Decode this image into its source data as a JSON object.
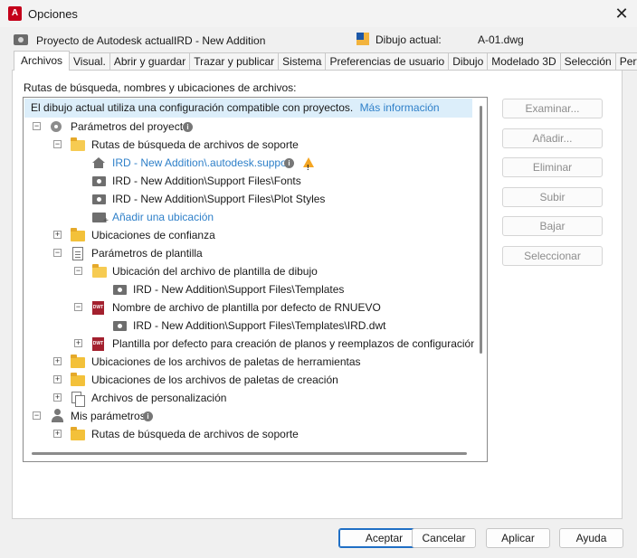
{
  "window": {
    "title": "Opciones",
    "app_icon_letter": "A",
    "close_glyph": "✕"
  },
  "header": {
    "project_label": "Proyecto de Autodesk actual:",
    "project_value": "IRD - New Addition",
    "drawing_label": "Dibujo actual:",
    "drawing_value": "A-01.dwg"
  },
  "tabs": [
    "Archivos",
    "Visual.",
    "Abrir y guardar",
    "Trazar y publicar",
    "Sistema",
    "Preferencias de usuario",
    "Dibujo",
    "Modelado 3D",
    "Selección",
    "Perfil"
  ],
  "active_tab": "Archivos",
  "panel": {
    "caption": "Rutas de búsqueda, nombres y ubicaciones de archivos:",
    "banner_text": "El dibujo actual utiliza una configuración compatible con proyectos.",
    "banner_link": "Más información"
  },
  "tree": [
    {
      "label": "Parámetros del proyecto",
      "icon": "gear-icon",
      "has_info": true
    },
    {
      "label": "Rutas de búsqueda de archivos de soporte",
      "icon": "folder-open-icon"
    },
    {
      "label": "IRD - New Addition\\.autodesk.support",
      "icon": "house-icon",
      "link": true,
      "has_info": true,
      "has_warning": true
    },
    {
      "label": "IRD - New Addition\\Support Files\\Fonts",
      "icon": "folder-path-icon"
    },
    {
      "label": "IRD - New Addition\\Support Files\\Plot Styles",
      "icon": "folder-path-icon"
    },
    {
      "label": "Añadir una ubicación",
      "icon": "add-folder-icon",
      "link": true
    },
    {
      "label": "Ubicaciones de confianza",
      "icon": "folder-icon"
    },
    {
      "label": "Parámetros de plantilla",
      "icon": "document-icon"
    },
    {
      "label": "Ubicación del archivo de plantilla de dibujo",
      "icon": "folder-open-icon"
    },
    {
      "label": "IRD - New Addition\\Support Files\\Templates",
      "icon": "folder-path-icon"
    },
    {
      "label": "Nombre de archivo de plantilla por defecto de RNUEVO",
      "icon": "dwt-icon",
      "icon_text": "DWT"
    },
    {
      "label": "IRD - New Addition\\Support Files\\Templates\\IRD.dwt",
      "icon": "folder-path-icon"
    },
    {
      "label": "Plantilla por defecto para creación de planos y reemplazos de configuración de págir",
      "icon": "dwt-icon",
      "icon_text": "DWT"
    },
    {
      "label": "Ubicaciones de los archivos de paletas de herramientas",
      "icon": "folder-icon"
    },
    {
      "label": "Ubicaciones de los archivos de paletas de creación",
      "icon": "folder-icon"
    },
    {
      "label": "Archivos de personalización",
      "icon": "multi-document-icon"
    },
    {
      "label": "Mis parámetros",
      "icon": "person-icon",
      "has_info": true
    },
    {
      "label": "Rutas de búsqueda de archivos de soporte",
      "icon": "folder-icon"
    }
  ],
  "side_buttons": [
    "Examinar...",
    "Añadir...",
    "Eliminar",
    "Subir",
    "Bajar",
    "Seleccionar"
  ],
  "footer_buttons": {
    "ok": "Aceptar",
    "cancel": "Cancelar",
    "apply": "Aplicar",
    "help": "Ayuda"
  },
  "colors": {
    "link": "#2f80c9",
    "banner_bg": "#dceefa",
    "primary_border": "#1f6fc5",
    "warning": "#f5a623"
  }
}
